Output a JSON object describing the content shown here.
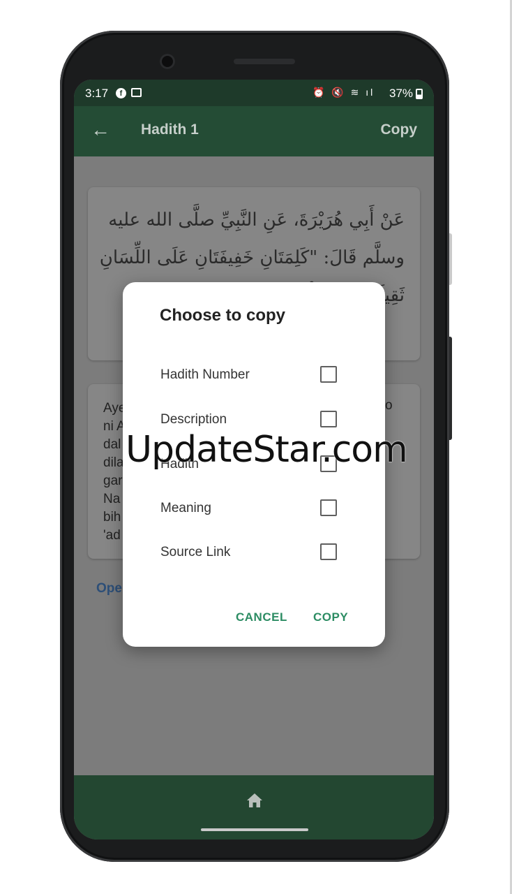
{
  "status_bar": {
    "time": "3:17",
    "icons": "⏰ 🔇 ≋ ıl",
    "battery": "37%"
  },
  "app_bar": {
    "title": "Hadith 1",
    "copy_action": "Copy"
  },
  "hadith": {
    "arabic": "عَنْ أَبِي هُرَيْرَةَ، عَنِ النَّبِيِّ صلَّى الله عليه وسلَّم قَالَ: \"كَلِمَتَانِ خَفِيفَتَانِ عَلَى اللِّسَانِ ثَقِيلَتَانِ فِي الْمِيـ... وَبِـ...",
    "translation": "Aye\nni A\ndal\ndila\ngar\nNa\nbih\n'ad",
    "translation_tail": "o",
    "open_link": "Ope"
  },
  "dialog": {
    "title": "Choose to copy",
    "options": [
      {
        "label": "Hadith Number",
        "checked": false
      },
      {
        "label": "Description",
        "checked": false
      },
      {
        "label": "Hadith",
        "checked": false
      },
      {
        "label": "Meaning",
        "checked": false
      },
      {
        "label": "Source Link",
        "checked": false
      }
    ],
    "cancel_label": "CANCEL",
    "copy_label": "COPY"
  },
  "watermark": "UpdateStar.com",
  "colors": {
    "app_bar": "#244c35",
    "accent": "#2c8c63",
    "scrim": "#7c7c7c"
  }
}
